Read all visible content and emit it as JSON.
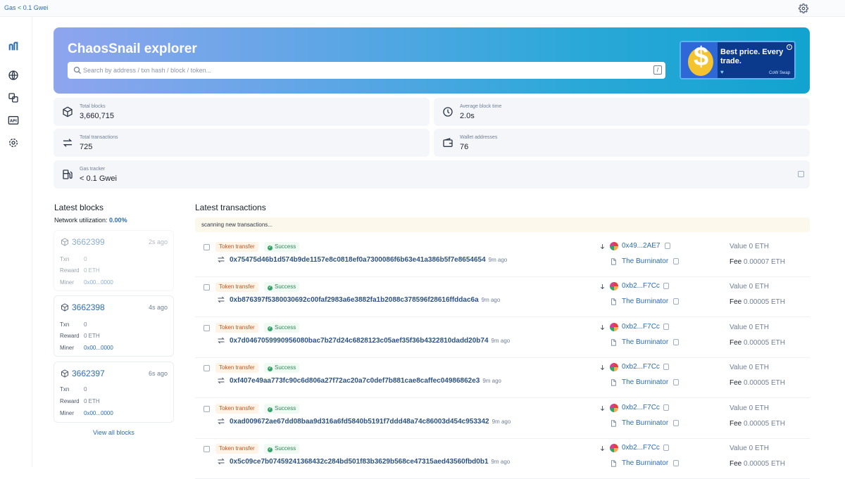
{
  "topbar": {
    "gas": "Gas < 0.1 Gwei"
  },
  "hero": {
    "title": "ChaosSnail explorer",
    "search_placeholder": "Search by address / txn hash / block / token...",
    "slash": "/"
  },
  "ad": {
    "text": "Best price. Every trade.",
    "brand": "CoW Swap",
    "info": "i"
  },
  "stats": {
    "total_blocks": {
      "label": "Total blocks",
      "value": "3,660,715"
    },
    "avg_block_time": {
      "label": "Average block time",
      "value": "2.0s"
    },
    "total_tx": {
      "label": "Total transactions",
      "value": "725"
    },
    "wallets": {
      "label": "Wallet addresses",
      "value": "76"
    },
    "gas": {
      "label": "Gas tracker",
      "value": "< 0.1 Gwei"
    }
  },
  "latest_blocks": {
    "title": "Latest blocks",
    "net_label": "Network utilization:",
    "net_value": "0.00%",
    "view_all": "View all blocks",
    "labels": {
      "txn": "Txn",
      "reward": "Reward",
      "miner": "Miner"
    },
    "items": [
      {
        "number": "3662399",
        "ago": "2s ago",
        "txn": "0",
        "reward": "0 ETH",
        "miner": "0x00...0000"
      },
      {
        "number": "3662398",
        "ago": "4s ago",
        "txn": "0",
        "reward": "0 ETH",
        "miner": "0x00...0000"
      },
      {
        "number": "3662397",
        "ago": "6s ago",
        "txn": "0",
        "reward": "0 ETH",
        "miner": "0x00...0000"
      }
    ]
  },
  "latest_tx": {
    "title": "Latest transactions",
    "scanning": "scanning new transactions...",
    "value_label": "Value",
    "fee_label": "Fee",
    "items": [
      {
        "type": "Token transfer",
        "status": "Success",
        "hash": "0x75475d46b1d574b9de1157e8c0818ef0a7300086f6b63e41a386b5f7e8654654",
        "ago": "9m ago",
        "from": "0x49...2AE7",
        "to": "The Burninator",
        "value": "0 ETH",
        "fee": "0.00007 ETH"
      },
      {
        "type": "Token transfer",
        "status": "Success",
        "hash": "0xb876397f5380030692c00faf2983a6e3882fa1b2088c378596f28616ffddac6a",
        "ago": "9m ago",
        "from": "0xb2...F7Cc",
        "to": "The Burninator",
        "value": "0 ETH",
        "fee": "0.00005 ETH"
      },
      {
        "type": "Token transfer",
        "status": "Success",
        "hash": "0x7d0467059990956080bac7b27d24c6828123c05aef35f36b4322810dadd20b74",
        "ago": "9m ago",
        "from": "0xb2...F7Cc",
        "to": "The Burninator",
        "value": "0 ETH",
        "fee": "0.00005 ETH"
      },
      {
        "type": "Token transfer",
        "status": "Success",
        "hash": "0xf407e49aa773fc90c6d806a27f72ac20a7c0def7b881cae8caffec04986862e3",
        "ago": "9m ago",
        "from": "0xb2...F7Cc",
        "to": "The Burninator",
        "value": "0 ETH",
        "fee": "0.00005 ETH"
      },
      {
        "type": "Token transfer",
        "status": "Success",
        "hash": "0xad009672ae67dd08baa9d316a6fd5840b5191f7ddd48a74c86003d454c953342",
        "ago": "9m ago",
        "from": "0xb2...F7Cc",
        "to": "The Burninator",
        "value": "0 ETH",
        "fee": "0.00005 ETH"
      },
      {
        "type": "Token transfer",
        "status": "Success",
        "hash": "0x5c09ce7b07459241368432c284bd501f83b3629b568ce47315aed43560fbd0b1",
        "ago": "9m ago",
        "from": "0xb2...F7Cc",
        "to": "The Burninator",
        "value": "0 ETH",
        "fee": "0.00005 ETH"
      }
    ]
  },
  "icons": {
    "topbar": "gear-icon",
    "sidebar": [
      "logo-icon",
      "globe-icon",
      "tokens-icon",
      "api-icon",
      "gear-icon"
    ],
    "stats": [
      "cube-icon",
      "clock-icon",
      "swap-icon",
      "wallet-icon",
      "gas-pump-icon"
    ]
  },
  "colors": {
    "accent": "#2b6cb0",
    "hero_start": "#8fa5ee",
    "hero_end": "#12a3cf",
    "success": "#38a169",
    "tag": "#c05621"
  }
}
